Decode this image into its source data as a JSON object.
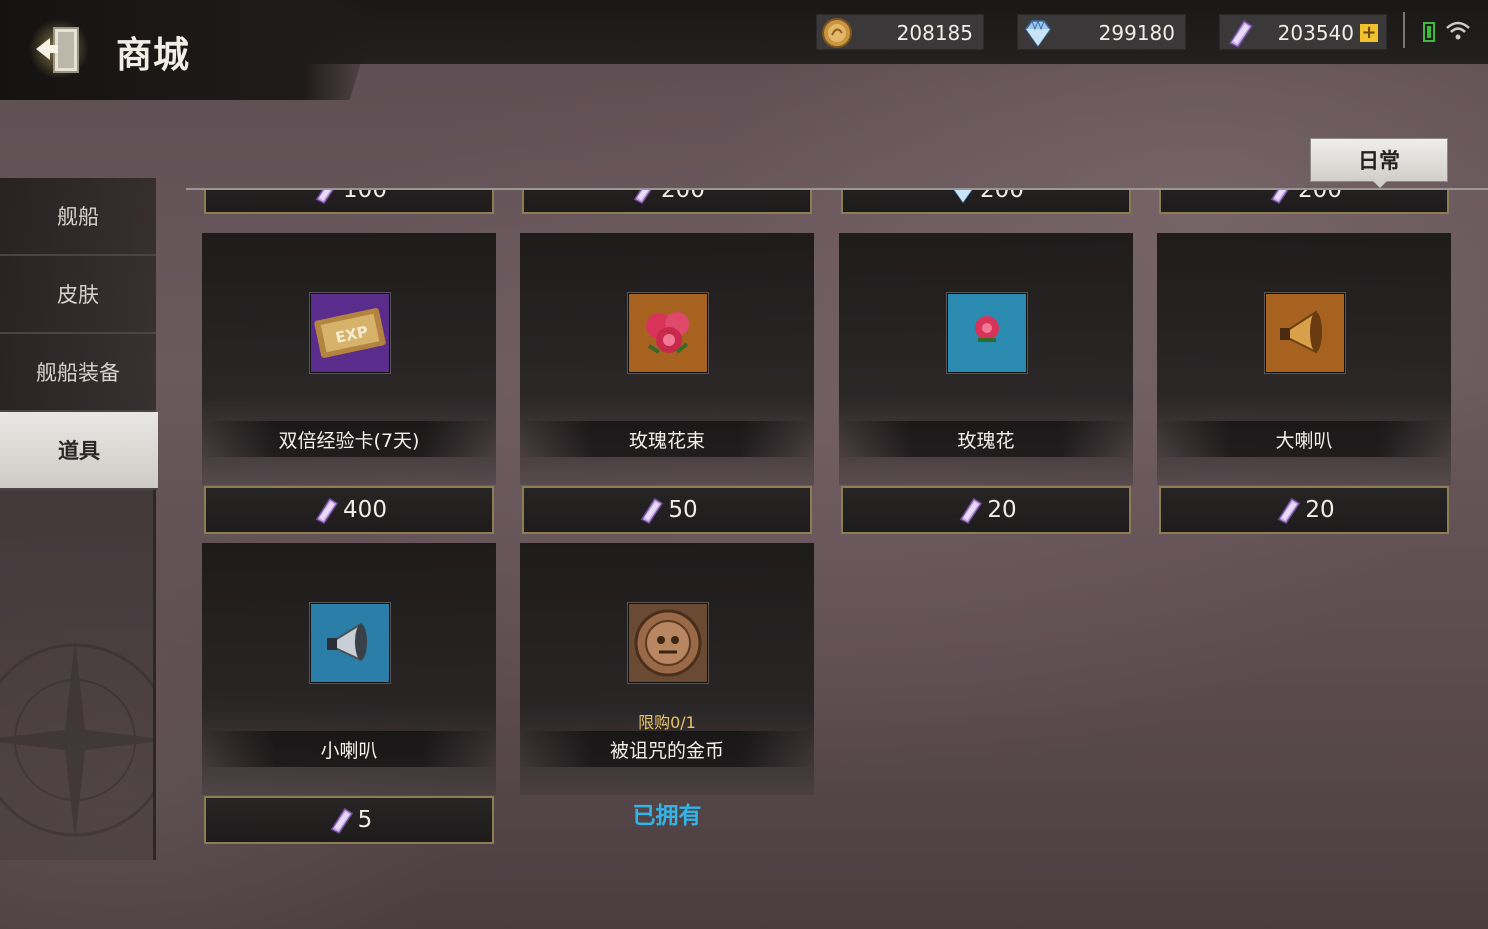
{
  "header": {
    "title": "商城",
    "back_icon": "exit-door-icon"
  },
  "currencies": [
    {
      "icon": "gold-coin-icon",
      "value": "208185"
    },
    {
      "icon": "diamond-icon",
      "value": "299180"
    },
    {
      "icon": "ticket-icon",
      "value": "203540",
      "plus": "+"
    }
  ],
  "status": {
    "battery_icon": "battery-icon",
    "wifi_icon": "wifi-icon"
  },
  "sidebar": {
    "items": [
      {
        "label": "舰船",
        "active": false
      },
      {
        "label": "皮肤",
        "active": false
      },
      {
        "label": "舰船装备",
        "active": false
      },
      {
        "label": "道具",
        "active": true
      }
    ]
  },
  "filter": {
    "label": "日常"
  },
  "top_partial_prices": [
    {
      "currency": "ticket",
      "amount": "100"
    },
    {
      "currency": "ticket",
      "amount": "200"
    },
    {
      "currency": "diamond",
      "amount": "200"
    },
    {
      "currency": "ticket",
      "amount": "200"
    }
  ],
  "items": [
    {
      "name": "双倍经验卡(7天)",
      "icon": "exp-card-icon",
      "price": "400",
      "currency": "ticket"
    },
    {
      "name": "玫瑰花束",
      "icon": "rose-bouquet-icon",
      "price": "50",
      "currency": "ticket"
    },
    {
      "name": "玫瑰花",
      "icon": "rose-icon",
      "price": "20",
      "currency": "ticket"
    },
    {
      "name": "大喇叭",
      "icon": "big-horn-icon",
      "price": "20",
      "currency": "ticket"
    },
    {
      "name": "小喇叭",
      "icon": "small-horn-icon",
      "price": "5",
      "currency": "ticket"
    },
    {
      "name": "被诅咒的金币",
      "icon": "cursed-coin-icon",
      "limit": "限购0/1",
      "status": "已拥有"
    }
  ],
  "colors": {
    "accent_gold_border": "#8c7d52",
    "owned_blue": "#34b3e6",
    "limit_gold": "#e8c36a"
  }
}
